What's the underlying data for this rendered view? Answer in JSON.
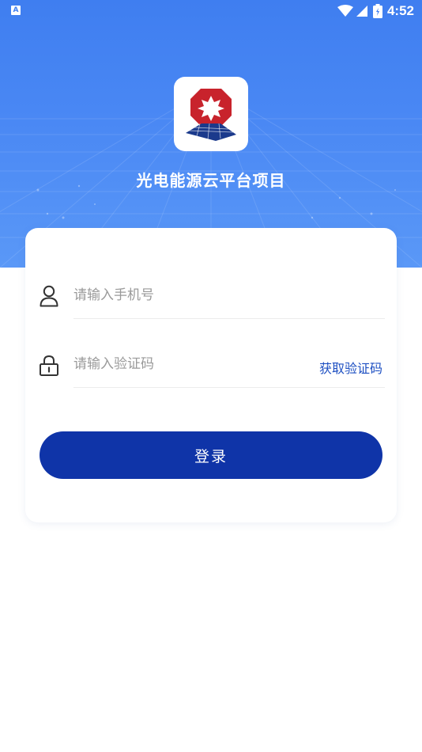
{
  "status_bar": {
    "app_indicator": "A",
    "time": "4:52",
    "icons": [
      "wifi-icon",
      "cellular-signal-icon",
      "battery-icon"
    ]
  },
  "app": {
    "title": "光电能源云平台项目",
    "logo": "solar-panel-logo"
  },
  "login_form": {
    "phone_placeholder": "请输入手机号",
    "code_placeholder": "请输入验证码",
    "get_code_label": "获取验证码",
    "login_label": "登录"
  },
  "colors": {
    "hero_blue": "#4a88f4",
    "button_blue": "#0f34a8",
    "link_blue": "#1d4fc2",
    "logo_red": "#c8232c"
  }
}
